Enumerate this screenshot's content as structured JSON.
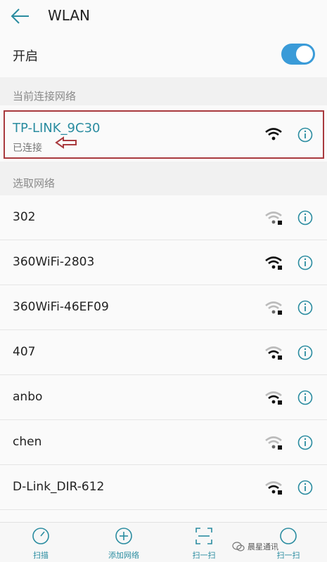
{
  "header": {
    "title": "WLAN"
  },
  "toggle": {
    "label": "开启",
    "on": true
  },
  "sections": {
    "current": "当前连接网络",
    "select": "选取网络"
  },
  "current_network": {
    "ssid": "TP-LINK_9C30",
    "status": "已连接"
  },
  "networks": [
    {
      "ssid": "302"
    },
    {
      "ssid": "360WiFi-2803"
    },
    {
      "ssid": "360WiFi-46EF09"
    },
    {
      "ssid": "407"
    },
    {
      "ssid": "anbo"
    },
    {
      "ssid": "chen"
    },
    {
      "ssid": "D-Link_DIR-612"
    }
  ],
  "bottom_bar": {
    "scan": "扫描",
    "add": "添加网络",
    "scan_qr": "扫一扫",
    "more": "扫一扫"
  },
  "watermark": "晨星通讯",
  "colors": {
    "accent": "#2a8ca0",
    "switch": "#3a9bd8",
    "highlight": "#a93a3e"
  }
}
